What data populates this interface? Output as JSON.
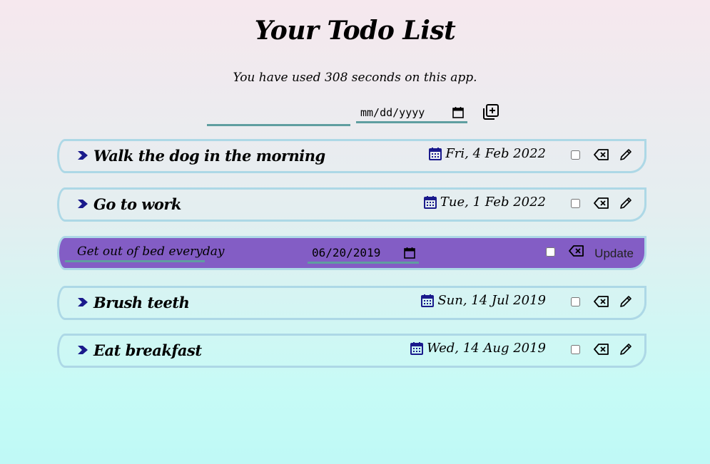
{
  "title": "Your Todo List",
  "timer_text": "You have used 308 seconds on this app.",
  "add_form": {
    "text_value": "",
    "date_placeholder": "mm/dd/yyyy"
  },
  "todos": [
    {
      "text": "Walk the dog in the morning",
      "date": "Fri, 4 Feb 2022",
      "checked": false
    },
    {
      "text": "Go to work",
      "date": "Tue, 1 Feb 2022",
      "checked": false
    },
    {
      "text": "Get out of bed everyday",
      "date": "06/20/2019",
      "checked": false,
      "editing": true,
      "update_label": "Update"
    },
    {
      "text": "Brush teeth",
      "date": "Sun, 14 Jul 2019",
      "checked": false
    },
    {
      "text": "Eat breakfast",
      "date": "Wed, 14 Aug 2019",
      "checked": false
    }
  ],
  "colors": {
    "accent_blue": "#1a1a8c",
    "editing_bg": "#835dc5",
    "input_underline": "#5f9ea0",
    "item_border": "#add8e6"
  },
  "icons": {
    "bullet": "chevron-right-icon",
    "date": "calendar-icon",
    "delete": "backspace-icon",
    "edit": "pencil-icon",
    "add": "add-square-icon"
  }
}
